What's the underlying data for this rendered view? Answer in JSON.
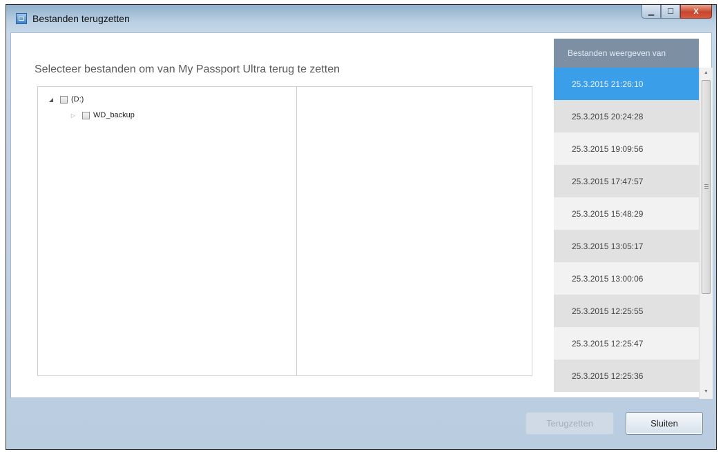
{
  "window": {
    "title": "Bestanden terugzetten",
    "icons": {
      "app": "app-icon",
      "minimize": "minimize-icon",
      "maximize": "maximize-icon",
      "close": "close-icon"
    },
    "close_glyph": "X"
  },
  "main": {
    "prompt": "Selecteer bestanden om van My Passport Ultra terug te zetten",
    "tree": [
      {
        "label": "(D:)",
        "expanded": true
      },
      {
        "label": "WD_backup",
        "expanded": false
      }
    ]
  },
  "sidebar": {
    "header": "Bestanden weergeven van",
    "selected_index": 0,
    "dates": [
      "25.3.2015 21:26:10",
      "25.3.2015 20:24:28",
      "25.3.2015 19:09:56",
      "25.3.2015 17:47:57",
      "25.3.2015 15:48:29",
      "25.3.2015 13:05:17",
      "25.3.2015 13:00:06",
      "25.3.2015 12:25:55",
      "25.3.2015 12:25:47",
      "25.3.2015 12:25:36"
    ]
  },
  "footer": {
    "restore_label": "Terugzetten",
    "close_label": "Sluiten"
  },
  "colors": {
    "selected_row": "#3b9ee8",
    "header_bg": "#7d8fa2",
    "footer_bg": "#c7d8e8"
  }
}
